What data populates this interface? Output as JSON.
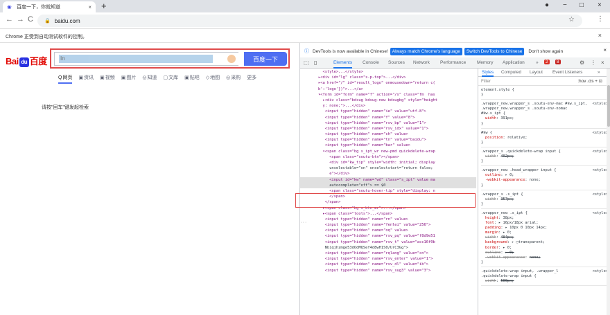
{
  "browser": {
    "tab_title": "百度一下，你就知道",
    "tab_close": "×",
    "new_tab": "+",
    "window_controls": [
      "●",
      "−",
      "□",
      "×"
    ],
    "url": "baidu.com",
    "infobar_text": "Chrome 正受到自动测试软件的控制。",
    "infobar_close": "×",
    "back": "←",
    "forward": "→",
    "reload": "C",
    "star": "☆",
    "menu": "⋮"
  },
  "page": {
    "logo_left": "Bai",
    "logo_paw": "du",
    "logo_right": "百度",
    "search_value": "In",
    "search_button": "百度一下",
    "nav_tabs": [
      {
        "icon": "Q",
        "label": "网页"
      },
      {
        "icon": "▣",
        "label": "资讯"
      },
      {
        "icon": "▣",
        "label": "视频"
      },
      {
        "icon": "▣",
        "label": "图片"
      },
      {
        "icon": "◎",
        "label": "知道"
      },
      {
        "icon": "▢",
        "label": "文库"
      },
      {
        "icon": "▣",
        "label": "贴吧"
      },
      {
        "icon": "◇",
        "label": "地图"
      },
      {
        "icon": "◎",
        "label": "采购"
      },
      {
        "icon": "",
        "label": "更多"
      }
    ],
    "hint": "请按\"回车\"键发起检索"
  },
  "devtools": {
    "banner": {
      "text": "DevTools is now available in Chinese!",
      "btn1": "Always match Chrome's language",
      "btn2": "Switch DevTools to Chinese",
      "btn3": "Don't show again",
      "close": "×"
    },
    "tabs": [
      "Elements",
      "Console",
      "Sources",
      "Network",
      "Performance",
      "Memory",
      "Application",
      "»"
    ],
    "badge_errors": "2",
    "badge_warnings": "8",
    "tree_lines": [
      "          <style>...</style>",
      "        ▸<div id=\"lg\" class=\"s-p-top\">...</div>",
      "        ▸<a href=\"/\" id=\"result_logo\" onmousedown=\"return c(",
      "        b':'logo'})\">...</a>",
      "        ▾<form id=\"form\" name=\"f\" action=\"/s\" class=\"fm  has",
      "          ▸<div class=\"bdsug bdsug-new bdsugbg\" style=\"height",
      "          y: none;\">...</div>",
      "           <input type=\"hidden\" name=\"ie\" value=\"utf-8\">",
      "           <input type=\"hidden\" name=\"f\" value=\"8\">",
      "           <input type=\"hidden\" name=\"rsv_bp\" value=\"1\">",
      "           <input type=\"hidden\" name=\"rsv_idx\" value=\"1\">",
      "           <input type=\"hidden\" name=\"ch\" value>",
      "           <input type=\"hidden\" name=\"tn\" value=\"baidu\">",
      "           <input type=\"hidden\" name=\"bar\" value>",
      "          ▾<span class=\"bg s_ipt_wr new-pmd quickdelete-wrap",
      "             <span class=\"soutu-btn\"></span>",
      "             <div id=\"kw_tip\" style=\"width: initial; display",
      "             unselectable=\"on\" onselectstart=\"return false;",
      "             e\"></div>",
      "             <input id=\"kw\" name=\"wd\" class=\"s_ipt\" value ma",
      "             autocomplete=\"off\"> == $0",
      "             <span class=\"soutu-hover-tip\" style=\"display: n",
      "             </span>",
      "           </span>",
      "          ▸<span class=\"bg s_btn_wr\">...</span>",
      "          ▸<span class=\"tools\">...</span>",
      "           <input type=\"hidden\" name=\"rn\" value>",
      "           <input type=\"hidden\" name=\"fenlei\" value=\"256\">",
      "           <input type=\"hidden\" name=\"oq\" value>",
      "           <input type=\"hidden\" name=\"rsv_pq\" value=\"f8d9e51",
      "           <input type=\"hidden\" name=\"rsv_t\" value=\"acc16f0b",
      "           Nbiqjhzmge53dOdMQSef4d8wH1S0/UrC3Gg\">",
      "           <input type=\"hidden\" name=\"rqlang\" value=\"cn\">",
      "           <input type=\"hidden\" name=\"rsv_enter\" value=\"1\">",
      "           <input type=\"hidden\" name=\"rsv_dl\" value=\"ib\">",
      "           <input type=\"hidden\" name=\"rsv_sug3\" value=\"3\">"
    ],
    "tree_gutter": "···",
    "styles_tabs": [
      "Styles",
      "Computed",
      "Layout",
      "Event Listeners",
      "»"
    ],
    "filter_placeholder": "Filter",
    "filter_right": ":hov .cls + ⊡",
    "rules": [
      {
        "selector": "element.style {",
        "source": "",
        "props": [],
        "close": "}"
      },
      {
        "selector": ".wrapper_new.wrapper_s .soutu-env-mac #kw.s_ipt, .wrapper_new.wrapper_s .soutu-env-nomac #kw.s_ipt {",
        "source": "<style>",
        "props": [
          {
            "name": "width",
            "value": "391px;",
            "strike": false
          }
        ],
        "close": "}"
      },
      {
        "selector": "#kw {",
        "source": "<style>",
        "props": [
          {
            "name": "position",
            "value": "relative;",
            "strike": false
          }
        ],
        "close": "}"
      },
      {
        "selector": ".wrapper_s .quickdelete-wrap input {",
        "source": "<style>",
        "props": [
          {
            "name": "width",
            "value": "402px;",
            "strike": true
          }
        ],
        "close": "}"
      },
      {
        "selector": ".wrapper_new .head_wrapper input {",
        "source": "<style>",
        "props": [
          {
            "name": "outline",
            "value": "▸ 0;",
            "strike": false
          },
          {
            "name": "-webkit-appearance",
            "value": "none;",
            "strike": false
          }
        ],
        "close": "}"
      },
      {
        "selector": ".wrapper_s .s_ipt {",
        "source": "<style>",
        "props": [
          {
            "name": "width",
            "value": "357px;",
            "strike": true
          }
        ],
        "close": "}"
      },
      {
        "selector": ".wrapper_new .s_ipt {",
        "source": "<style>",
        "props": [
          {
            "name": "height",
            "value": "38px;",
            "strike": false
          },
          {
            "name": "font",
            "value": "▸ 16px/18px arial;",
            "strike": false
          },
          {
            "name": "padding",
            "value": "▸ 10px 0 10px 14px;",
            "strike": false
          },
          {
            "name": "margin",
            "value": "▸ 0;",
            "strike": false
          },
          {
            "name": "width",
            "value": "484px;",
            "strike": true
          },
          {
            "name": "background",
            "value": "▸ ▢transparent;",
            "strike": false
          },
          {
            "name": "border",
            "value": "▸ 0;",
            "strike": false
          },
          {
            "name": "outline",
            "value": "▸ 0;",
            "strike": true
          },
          {
            "name": "-webkit-appearance",
            "value": "none;",
            "strike": true
          }
        ],
        "close": "}"
      },
      {
        "selector": ".quickdelete-wrap input, .wrapper_l .quickdelete-wrap input {",
        "source": "<style>",
        "props": [
          {
            "name": "width",
            "value": "500px;",
            "strike": true
          }
        ],
        "close": ""
      }
    ]
  }
}
